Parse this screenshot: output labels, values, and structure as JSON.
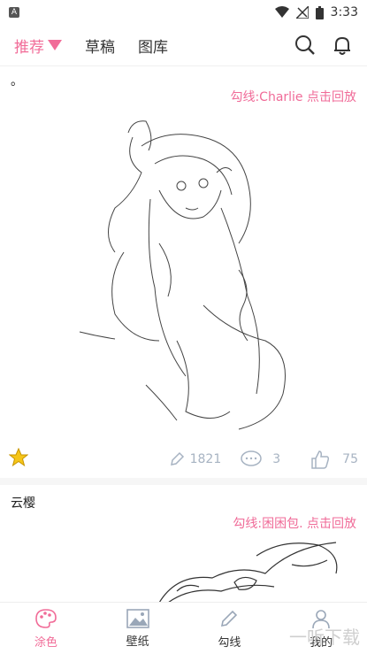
{
  "status_bar": {
    "time": "3:33",
    "app_icon_label": "A"
  },
  "tabs": [
    {
      "label": "推荐",
      "active": true
    },
    {
      "label": "草稿",
      "active": false
    },
    {
      "label": "图库",
      "active": false
    }
  ],
  "icons": {
    "search": "search-icon",
    "bell": "bell-icon"
  },
  "posts": [
    {
      "title": "。",
      "credit": "勾线:Charlie  点击回放",
      "pencil_count": "1821",
      "comment_count": "3",
      "like_count": "75"
    },
    {
      "title": "云樱",
      "credit": "勾线:困困包. 点击回放"
    }
  ],
  "bottom_nav": [
    {
      "label": "涂色",
      "active": true
    },
    {
      "label": "壁纸",
      "active": false
    },
    {
      "label": "勾线",
      "active": false
    },
    {
      "label": "我的",
      "active": false
    }
  ],
  "watermark": "一听下载",
  "colors": {
    "accent": "#f16c98",
    "stat_gray": "#a7b3c2"
  }
}
